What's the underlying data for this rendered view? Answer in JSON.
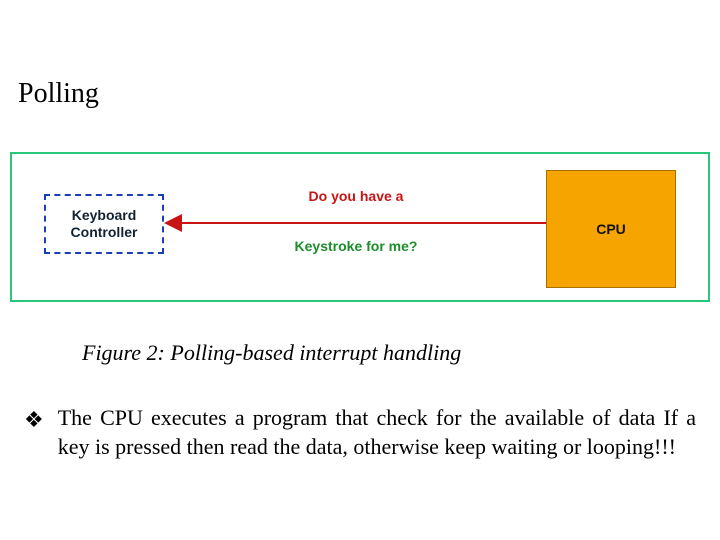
{
  "title": "Polling",
  "diagram": {
    "keyboard_box": "Keyboard Controller",
    "cpu_box": "CPU",
    "question_line1": "Do you have a",
    "question_line2": "Keystroke for me?"
  },
  "caption": "Figure 2: Polling-based interrupt handling",
  "bullet": {
    "glyph": "❖",
    "text": "The CPU executes a program that check for the available of data If a key is pressed then read the data, otherwise keep waiting  or looping!!!"
  }
}
